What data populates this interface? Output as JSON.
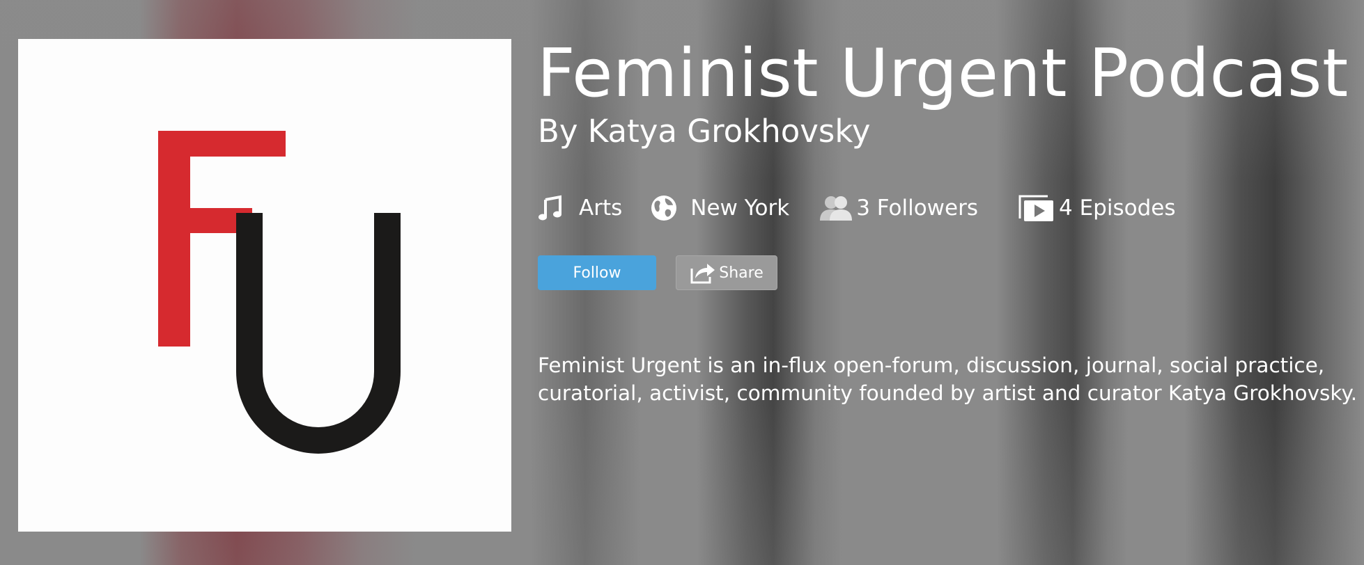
{
  "podcast": {
    "title": "Feminist Urgent Podcast",
    "author": "By Katya Grokhovsky",
    "description": "Feminist Urgent is an in-flux open-forum, discussion, journal, social practice, curatorial, activist, community founded by artist and curator Katya Grokhovsky.",
    "cover_logo": {
      "letters": "FU",
      "colors": {
        "f": "#d62a2f",
        "u": "#1b1a19"
      }
    }
  },
  "meta": {
    "category": {
      "icon": "music-note-icon",
      "label": "Arts"
    },
    "location": {
      "icon": "globe-icon",
      "label": "New York"
    },
    "followers": {
      "icon": "people-icon",
      "label": "3 Followers"
    },
    "episodes": {
      "icon": "video-play-icon",
      "label": "4 Episodes"
    }
  },
  "actions": {
    "follow_label": "Follow",
    "share_label": "Share",
    "share_icon": "share-arrow-icon"
  },
  "colors": {
    "follow_button": "#4aa3dc",
    "share_button": "#9a9a9a",
    "text": "#ffffff"
  }
}
